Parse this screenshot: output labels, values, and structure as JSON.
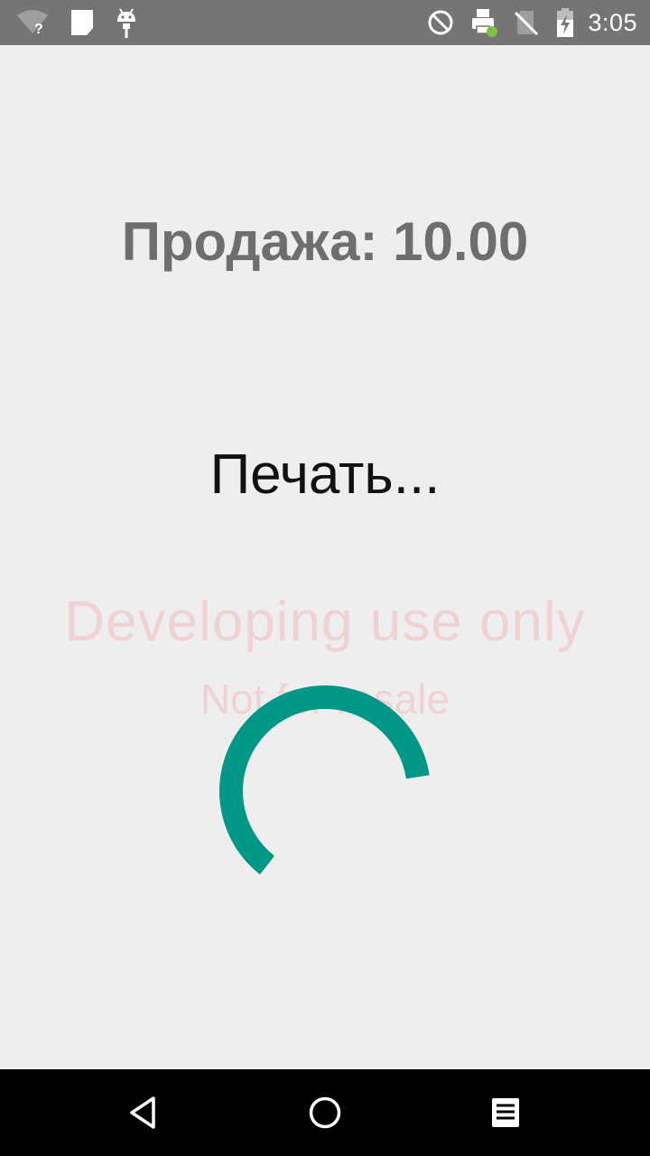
{
  "status_bar": {
    "time": "3:05",
    "left_icons": [
      "wifi-unknown-icon",
      "notification-card-icon",
      "android-debug-icon"
    ],
    "right_icons": [
      "do-not-disturb-icon",
      "printer-icon",
      "no-sim-icon",
      "battery-charging-icon"
    ],
    "printer_badge_color": "#7cc242"
  },
  "main": {
    "sale_label": "Продажа: 10.00",
    "printing_label": "Печать...",
    "watermark_line1": "Developing use only",
    "watermark_line2": "Not for resale"
  },
  "spinner": {
    "color": "#009688",
    "progress": 0.62
  },
  "nav_bar": {
    "buttons": [
      "back-icon",
      "home-icon",
      "recents-icon"
    ]
  },
  "colors": {
    "background": "#eeeeee",
    "status_bar": "#757575",
    "nav_bar": "#000000",
    "watermark": "#f1d2d3",
    "title_text": "#6e6e6e"
  }
}
